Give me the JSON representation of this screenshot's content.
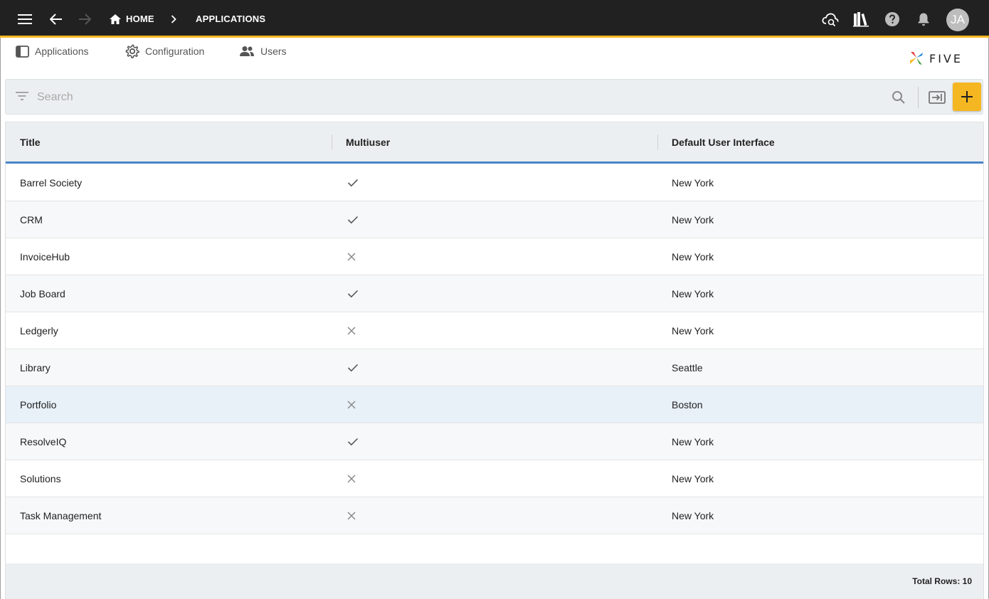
{
  "topbar": {
    "menu_icon": "hamburger-menu-icon",
    "back_icon": "arrow-left-icon",
    "forward_icon": "arrow-right-icon",
    "breadcrumb": {
      "home_label": "HOME",
      "separator_icon": "chevron-right-icon",
      "current_label": "APPLICATIONS"
    },
    "right_icons": [
      "cloud-sync-icon",
      "library-icon",
      "help-icon",
      "bell-icon"
    ],
    "avatar_initials": "JA",
    "accent_color": "#f5b721"
  },
  "tabs": [
    {
      "label": "Applications",
      "icon": "applications-icon"
    },
    {
      "label": "Configuration",
      "icon": "gear-icon"
    },
    {
      "label": "Users",
      "icon": "users-icon"
    }
  ],
  "logo": {
    "text": "FIVE"
  },
  "search": {
    "placeholder": "Search",
    "value": ""
  },
  "table": {
    "columns": [
      "Title",
      "Multiuser",
      "Default User Interface"
    ],
    "header_accent": "#4a86c8",
    "selected_row_index": 6,
    "rows": [
      {
        "title": "Barrel Society",
        "multiuser": true,
        "ui": "New York"
      },
      {
        "title": "CRM",
        "multiuser": true,
        "ui": "New York"
      },
      {
        "title": "InvoiceHub",
        "multiuser": false,
        "ui": "New York"
      },
      {
        "title": "Job Board",
        "multiuser": true,
        "ui": "New York"
      },
      {
        "title": "Ledgerly",
        "multiuser": false,
        "ui": "New York"
      },
      {
        "title": "Library",
        "multiuser": true,
        "ui": "Seattle"
      },
      {
        "title": "Portfolio",
        "multiuser": false,
        "ui": "Boston"
      },
      {
        "title": "ResolveIQ",
        "multiuser": true,
        "ui": "New York"
      },
      {
        "title": "Solutions",
        "multiuser": false,
        "ui": "New York"
      },
      {
        "title": "Task Management",
        "multiuser": false,
        "ui": "New York"
      }
    ],
    "total_rows_label": "Total Rows: 10"
  }
}
